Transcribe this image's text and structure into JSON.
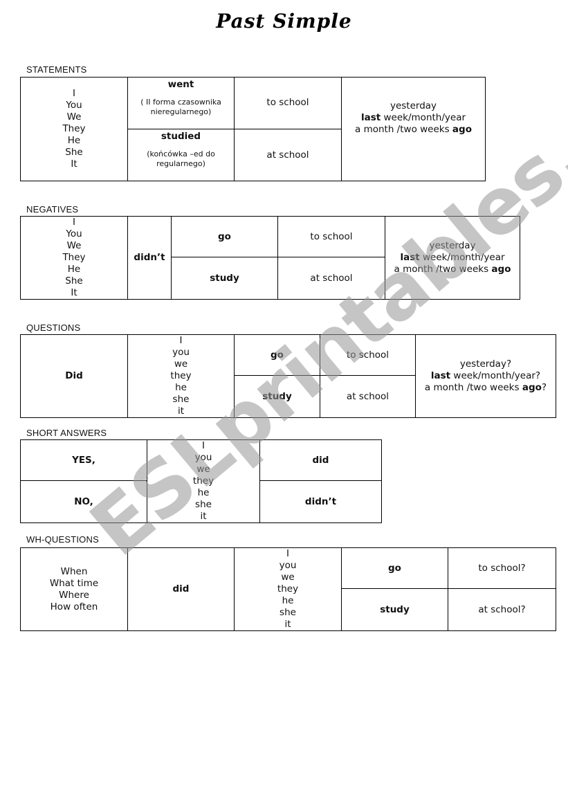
{
  "title": "Past Simple",
  "watermark": "ESLprintables.com",
  "statements": {
    "label": "STATEMENTS",
    "pronouns": [
      "I",
      "You",
      "We",
      "They",
      "He",
      "She",
      "It"
    ],
    "verb1": "went",
    "verb1_note": "( II forma czasownika nieregularnego)",
    "verb2": "studied",
    "verb2_note": "(końcówka –ed do regularnego)",
    "place1": "to school",
    "place2": "at school",
    "time": {
      "line1": "yesterday",
      "line2_bold": "last",
      "line2_rest": " week/month/year",
      "line3_rest": "a month /two weeks ",
      "line3_bold": "ago",
      "suffix": ""
    }
  },
  "negatives": {
    "label": "NEGATIVES",
    "pronouns": [
      "I",
      "You",
      "We",
      "They",
      "He",
      "She",
      "It"
    ],
    "auxiliary": "didn’t",
    "verb1": "go",
    "verb2": "study",
    "place1": "to school",
    "place2": "at school",
    "time": {
      "line1": "yesterday",
      "line2_bold": "last",
      "line2_rest": " week/month/year",
      "line3_rest": "a month /two weeks ",
      "line3_bold": "ago",
      "suffix": ""
    }
  },
  "questions": {
    "label": "QUESTIONS",
    "auxiliary": "Did",
    "pronouns": [
      "I",
      "you",
      "we",
      "they",
      "he",
      "she",
      "it"
    ],
    "verb1": "go",
    "verb2": "study",
    "place1": "to school",
    "place2": "at school",
    "time": {
      "line1": "yesterday?",
      "line2_bold": "last",
      "line2_rest": " week/month/year?",
      "line3_rest": "a month /two weeks ",
      "line3_bold": "ago",
      "suffix": "?"
    }
  },
  "short_answers": {
    "label": "SHORT ANSWERS",
    "yes": "YES,",
    "no": "NO,",
    "pronouns": [
      "I",
      "you",
      "we",
      "they",
      "he",
      "she",
      "it"
    ],
    "positive": "did",
    "negative": "didn’t"
  },
  "wh_questions": {
    "label": "WH-QUESTIONS",
    "words": [
      "When",
      "What time",
      "Where",
      "How often"
    ],
    "auxiliary": "did",
    "pronouns": [
      "I",
      "you",
      "we",
      "they",
      "he",
      "she",
      "it"
    ],
    "verb1": "go",
    "verb2": "study",
    "place1": "to school?",
    "place2": "at school?"
  }
}
